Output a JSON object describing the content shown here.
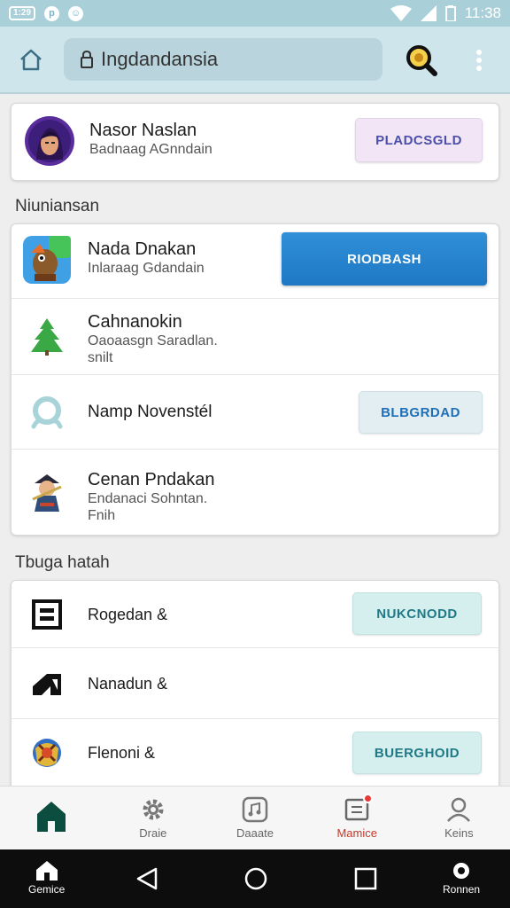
{
  "status_bar": {
    "chip_label": "1:29",
    "icon1": "p-icon",
    "icon2": "smiley-icon",
    "time": "11:38"
  },
  "app_bar": {
    "url": "Ingdandansia",
    "icons": [
      "home-icon",
      "lock-icon",
      "search-icon",
      "more-vert-icon"
    ]
  },
  "profile": {
    "name": "Nasor Naslan",
    "subtitle": "Badnaag AGnndain",
    "button": "PLADCSGLD"
  },
  "section1": {
    "title": "Niuniansan",
    "rows": [
      {
        "title": "Nada Dnakan",
        "subtitle": "Inlaraag Gdandain",
        "button": "RIODBASH",
        "icon": "game-character-icon"
      },
      {
        "title": "Cahnanokin",
        "subtitle": "Oaoaasgn Saradlan.",
        "subtitle2": "snilt",
        "icon": "tree-icon"
      },
      {
        "title": "Namp Novenstél",
        "button": "BLBGRDAD",
        "icon": "ring-icon"
      },
      {
        "title": "Cenan Pndakan",
        "subtitle": "Endanaci Sohntan.",
        "subtitle2": "Fnih",
        "icon": "warrior-icon"
      }
    ]
  },
  "section2": {
    "title": "Tbuga hatah",
    "rows": [
      {
        "title": "Rogedan &",
        "button": "NUKCNODD",
        "icon": "box-icon"
      },
      {
        "title": "Nanadun &",
        "icon": "slash-logo-icon"
      },
      {
        "title": "Flenoni &",
        "button": "BUERGHOID",
        "icon": "shield-game-icon"
      }
    ]
  },
  "bottom_nav": [
    {
      "label": "",
      "icon": "home-filled-icon"
    },
    {
      "label": "Draie",
      "icon": "gear-icon"
    },
    {
      "label": "Daaate",
      "icon": "media-icon"
    },
    {
      "label": "Mamice",
      "icon": "inbox-icon"
    },
    {
      "label": "Keins",
      "icon": "person-icon"
    }
  ],
  "system_nav": {
    "left_label": "Gemice",
    "right_label": "Ronnen"
  },
  "colors": {
    "accent_blue": "#1f78c4",
    "status_bar": "#a9cfd9",
    "app_bar": "#cfe5ec",
    "active_nav": "#0b4d3e",
    "badge": "#e53935"
  }
}
